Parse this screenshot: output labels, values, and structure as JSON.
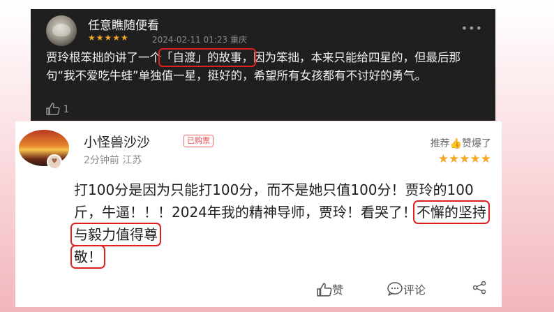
{
  "review_top": {
    "username": "任意瞧随便看",
    "stars": "★★★★★",
    "date_location": "2024-02-11 01:23 重庆",
    "more_icon": "ellipsis-icon",
    "text_before": "贾玲根笨拙的讲了一个",
    "text_highlight": "「自渡」的故事，",
    "text_after": "因为笨拙，本来只能给四星的，但最后那句“我不爱吃牛蛙”单独值一星，挺好的，希望所有女孩都有不讨好的勇气。",
    "like_count": "1"
  },
  "review_bottom": {
    "username": "小怪兽沙沙",
    "badge": "已购票",
    "time_location": "2分钟前  江苏",
    "recommend_prefix": "推荐",
    "recommend_suffix": "赞爆了",
    "stars": "★★★★★",
    "text_before": "打100分是因为只能打100分，而不是她只值100分！贾玲的100斤，牛逼！！！2024年我的精神导师，贾玲！看哭了！",
    "text_highlight_1": "不懈的坚持与毅力值得尊",
    "text_highlight_2": "敬！",
    "actions": {
      "like_label": "赞",
      "comment_label": "评论"
    }
  },
  "colors": {
    "highlight_border": "#e02020",
    "star": "#f5a623",
    "dark_card_bg": "#1f1f1f"
  }
}
